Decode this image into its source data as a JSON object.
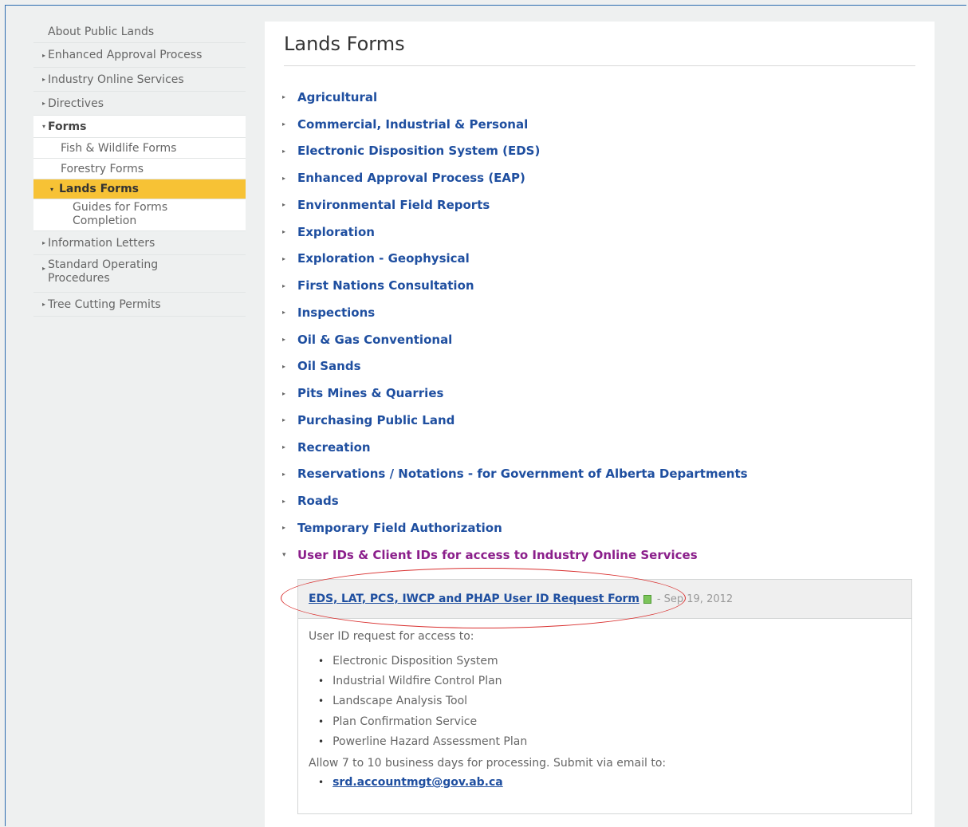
{
  "sidebar": {
    "items": [
      {
        "label": "About Public Lands"
      },
      {
        "label": "Enhanced Approval Process"
      },
      {
        "label": "Industry Online Services"
      },
      {
        "label": "Directives"
      },
      {
        "label": "Forms"
      },
      {
        "label": "Fish & Wildlife Forms"
      },
      {
        "label": "Forestry Forms"
      },
      {
        "label": "Lands Forms"
      },
      {
        "label": "Guides for Forms Completion"
      },
      {
        "label": "Information Letters"
      },
      {
        "label": "Standard Operating Procedures"
      },
      {
        "label": "Tree Cutting Permits"
      }
    ]
  },
  "main": {
    "title": "Lands Forms",
    "categories": [
      "Agricultural",
      "Commercial, Industrial & Personal",
      "Electronic Disposition System (EDS)",
      "Enhanced Approval Process (EAP)",
      "Environmental Field Reports",
      "Exploration",
      "Exploration - Geophysical",
      "First Nations Consultation",
      "Inspections",
      "Oil & Gas Conventional",
      "Oil Sands",
      "Pits Mines & Quarries",
      "Purchasing Public Land",
      "Recreation",
      "Reservations / Notations - for Government of Alberta Departments",
      "Roads",
      "Temporary Field Authorization",
      "User IDs & Client IDs for access to Industry Online Services"
    ],
    "panel": {
      "form_link": "EDS, LAT, PCS, IWCP and PHAP User ID Request Form",
      "form_date": "- Sep 19, 2012",
      "description": "User ID request for access to:",
      "items": [
        "Electronic Disposition System",
        "Industrial Wildfire Control Plan",
        "Landscape Analysis Tool",
        "Plan Confirmation Service",
        "Powerline Hazard Assessment Plan"
      ],
      "note": "Allow 7 to 10 business days for processing. Submit via email to:",
      "email": "srd.accountmgt@gov.ab.ca"
    }
  },
  "colors": {
    "link": "#1f4fa0",
    "active_category": "#8b1f8b",
    "active_nav": "#f7c235",
    "highlight": "#d9302f"
  },
  "icons": {
    "collapsed": "caret-right-icon",
    "expanded": "caret-down-icon",
    "document": "document-icon"
  }
}
